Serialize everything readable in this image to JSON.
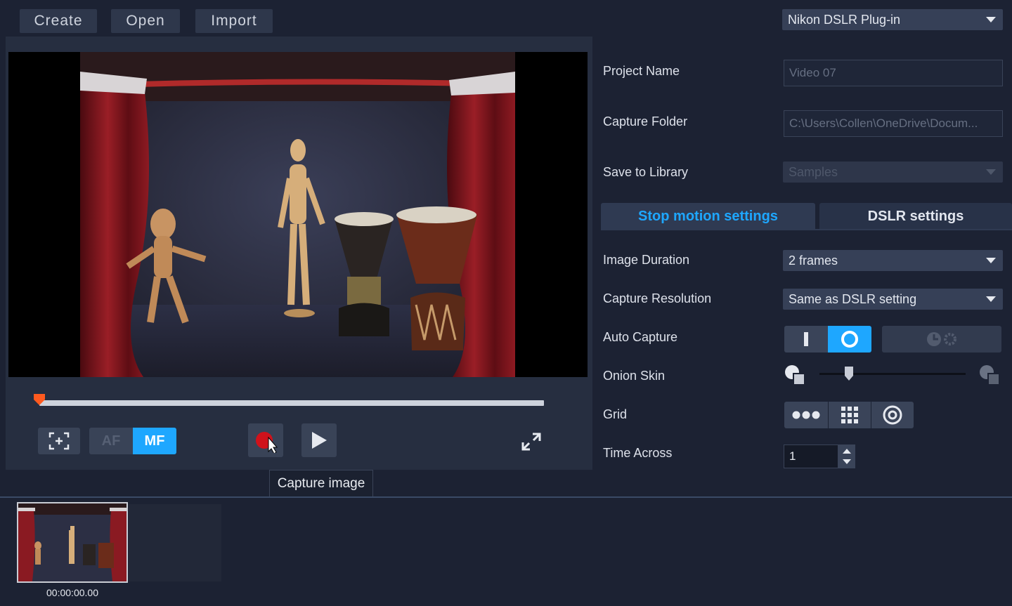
{
  "toolbar": {
    "create_label": "Create",
    "open_label": "Open",
    "import_label": "Import"
  },
  "source": {
    "selected": "Nikon DSLR Plug-in"
  },
  "project": {
    "name_label": "Project Name",
    "name_value": "Video 07",
    "folder_label": "Capture Folder",
    "folder_value": "C:\\Users\\Collen\\OneDrive\\Docum...",
    "library_label": "Save to Library",
    "library_value": "Samples"
  },
  "tabs": [
    {
      "label": "Stop motion settings",
      "active": true
    },
    {
      "label": "DSLR settings",
      "active": false
    }
  ],
  "settings": {
    "duration_label": "Image Duration",
    "duration_value": "2 frames",
    "resolution_label": "Capture Resolution",
    "resolution_value": "Same as DSLR setting",
    "auto_capture_label": "Auto Capture",
    "onion_label": "Onion Skin",
    "onion_level": 0.2,
    "grid_label": "Grid",
    "time_across_label": "Time Across",
    "time_across_value": "1"
  },
  "controls": {
    "af_label": "AF",
    "mf_label": "MF",
    "tooltip": "Capture image"
  },
  "timeline": {
    "clip_timecode": "00:00:00.00"
  },
  "colors": {
    "accent": "#1ea7ff",
    "record": "#d0121b",
    "scrub_head": "#ff5a1f"
  }
}
